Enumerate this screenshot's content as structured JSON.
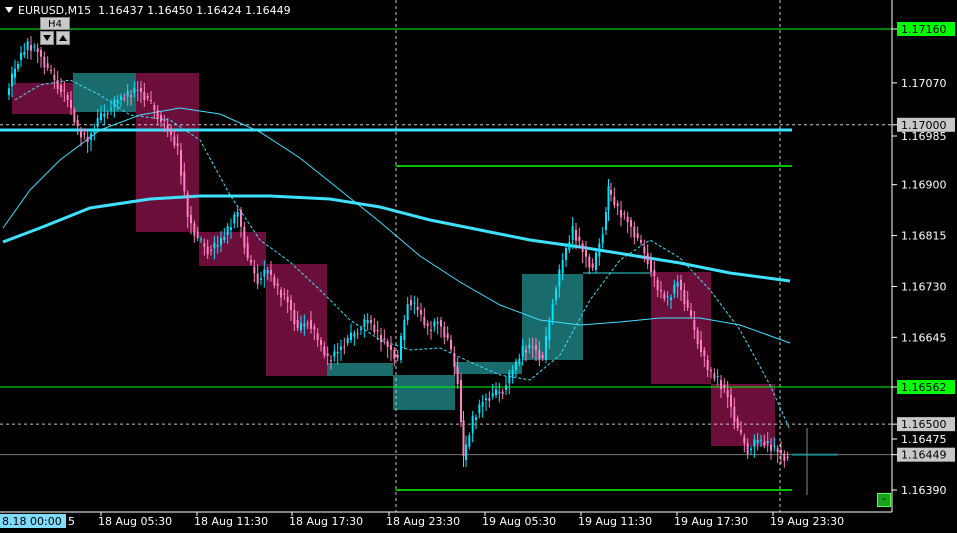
{
  "header": {
    "symbol_tf": "EURUSD,M15",
    "ohlc": "1.16437 1.16450 1.16424 1.16449"
  },
  "timeframe_box": {
    "label": "H4"
  },
  "price_axis": {
    "ticks": [
      "1.17160",
      "1.17070",
      "1.17000",
      "1.16985",
      "1.16900",
      "1.16815",
      "1.16730",
      "1.16645",
      "1.16562",
      "1.16500",
      "1.16475",
      "1.16449",
      "1.16390"
    ],
    "highlighted": {
      "1.17160": "#00ff00",
      "1.16562": "#00ff00",
      "1.17000": "#c8c8c8",
      "1.16500": "#c8c8c8",
      "1.16449": "#c8c8c8"
    }
  },
  "time_axis": {
    "first_label": "8.18 00:00",
    "first_label_suffix": "5",
    "ticks": [
      "18 Aug 05:30",
      "18 Aug 11:30",
      "18 Aug 17:30",
      "18 Aug 23:30",
      "19 Aug 05:30",
      "19 Aug 11:30",
      "19 Aug 17:30",
      "19 Aug 23:30"
    ]
  },
  "minimize_button": {
    "label": "-"
  },
  "colors": {
    "background": "#000000",
    "bull_candle": "#00e5ff",
    "bear_candle": "#ff80c0",
    "bull_h4_box": "#1a6b6b",
    "bear_h4_box": "#6b0f3a",
    "level_line": "#00ff00",
    "ma_line": "#40e0ff",
    "grid_dashed": "#c8c8c8"
  }
}
